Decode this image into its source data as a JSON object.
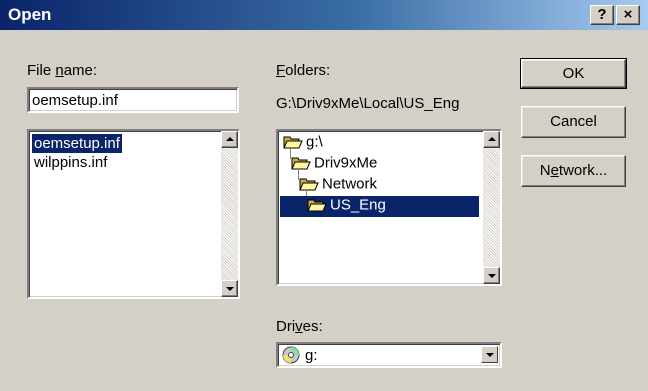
{
  "window": {
    "title": "Open"
  },
  "titlebar": {
    "help_label": "?",
    "close_label": "×"
  },
  "file_name": {
    "label_before": "File ",
    "label_access": "n",
    "label_after": "ame:",
    "value": "oemsetup.inf",
    "items": [
      {
        "label": "oemsetup.inf",
        "selected": true
      },
      {
        "label": "wilppins.inf",
        "selected": false
      }
    ]
  },
  "folders": {
    "label_access": "F",
    "label_after": "olders:",
    "path": "G:\\Driv9xMe\\Local\\US_Eng",
    "tree": [
      {
        "label": "g:\\",
        "icon": "open-folder-icon",
        "selected": false
      },
      {
        "label": "Driv9xMe",
        "icon": "open-folder-icon",
        "selected": false
      },
      {
        "label": "Network",
        "icon": "open-folder-icon",
        "selected": false
      },
      {
        "label": "US_Eng",
        "icon": "open-folder-icon",
        "selected": true
      }
    ]
  },
  "drives": {
    "label_before": "Dri",
    "label_access": "v",
    "label_after": "es:",
    "value": "g:",
    "icon": "cd-drive-icon"
  },
  "buttons": {
    "ok": "OK",
    "cancel": "Cancel",
    "network_before": "N",
    "network_access": "e",
    "network_after": "twork..."
  },
  "colors": {
    "titlebar_start": "#0a246a",
    "titlebar_end": "#a6caf0",
    "selection": "#0a246a",
    "face": "#d4d0c8"
  }
}
